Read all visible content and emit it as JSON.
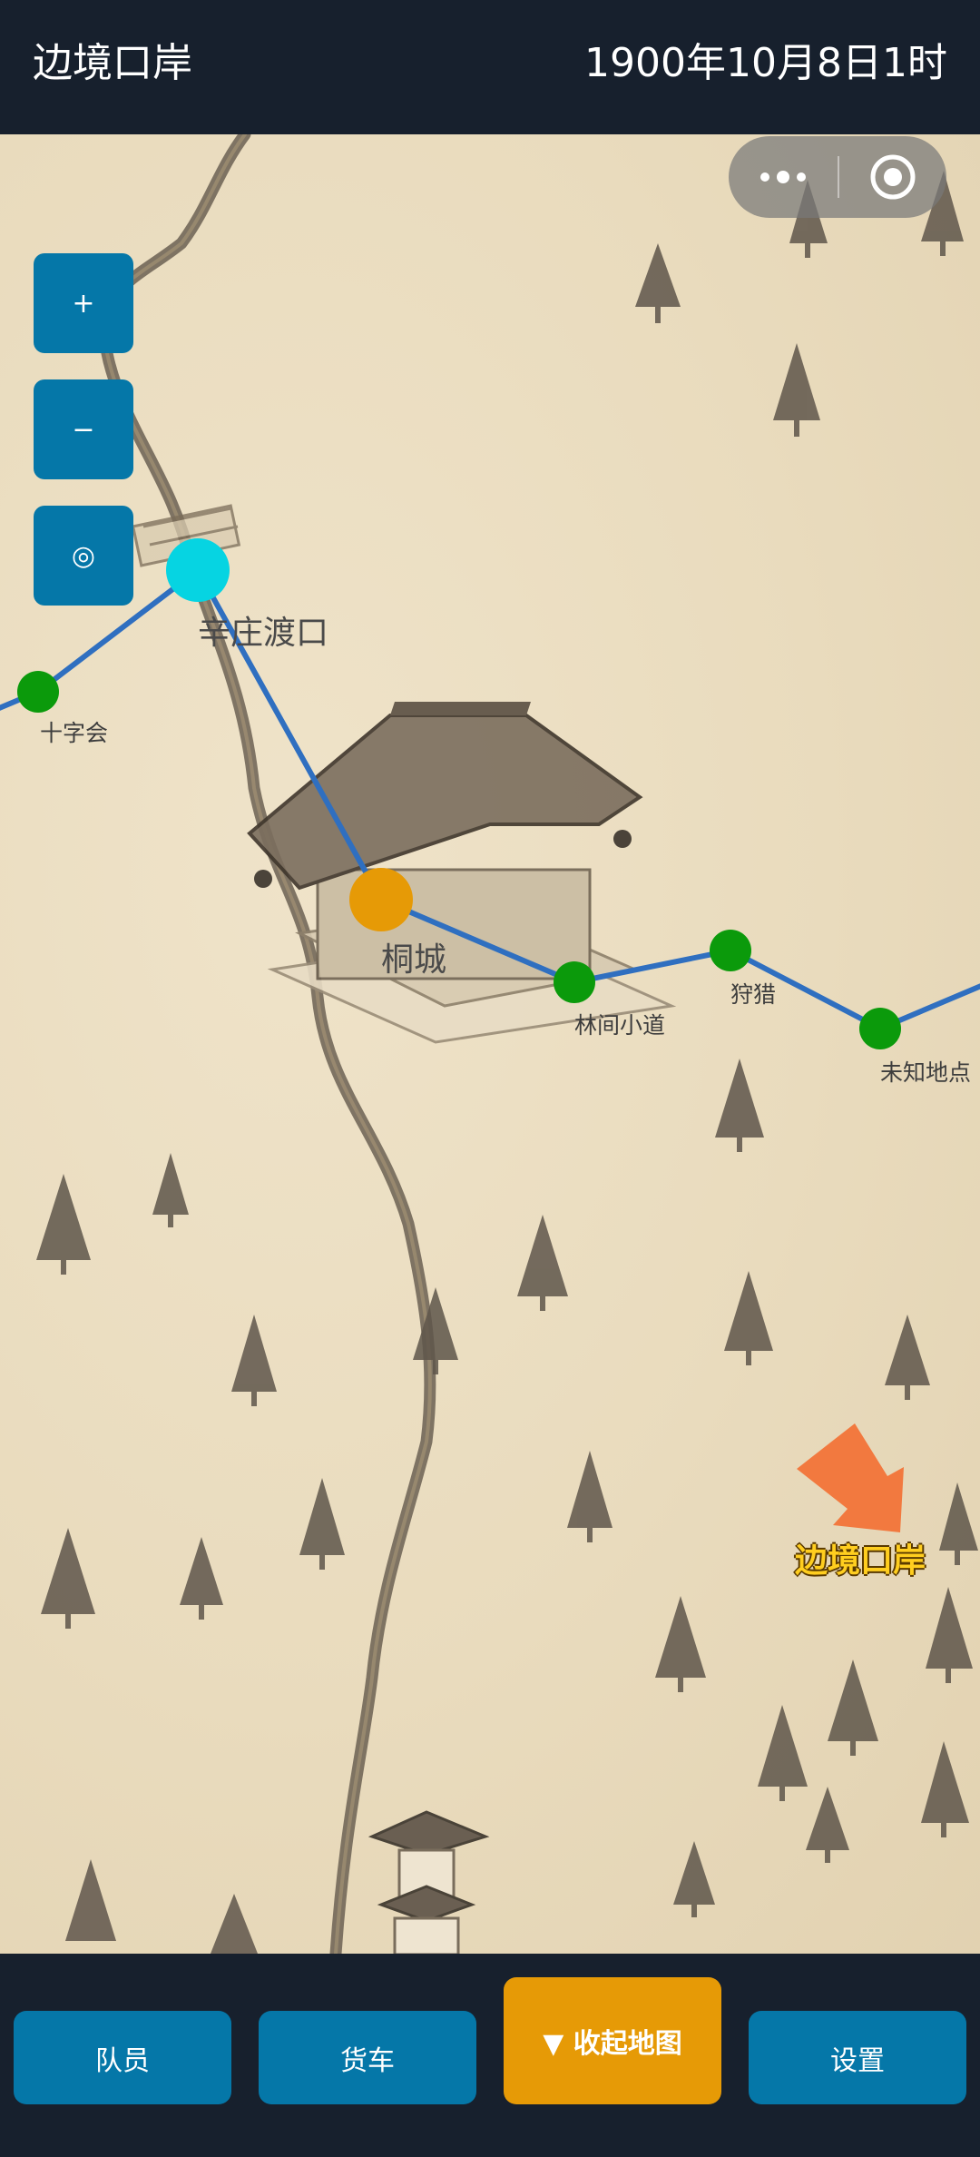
{
  "header": {
    "title": "边境口岸",
    "datetime": "1900年10月8日1时"
  },
  "capsule": {
    "more_icon": "more-dots-icon",
    "close_icon": "target-circle-icon"
  },
  "zoom_controls": {
    "zoom_in_label": "+",
    "zoom_out_label": "−",
    "locate_label": "◎"
  },
  "map": {
    "nodes": [
      {
        "name": "辛庄渡口",
        "status": "cyan"
      },
      {
        "name": "十字会",
        "status": "green"
      },
      {
        "name": "桐城",
        "status": "current"
      },
      {
        "name": "林间小道",
        "status": "green"
      },
      {
        "name": "狩猎",
        "status": "green"
      },
      {
        "name": "未知地点",
        "status": "green"
      }
    ],
    "destination": "边境口岸",
    "colors": {
      "route": "#2f6fc0",
      "node_green": "#0b9a0b",
      "node_cyan": "#06d4e2",
      "node_current": "#e69a06",
      "arrow": "#f2793f"
    }
  },
  "bottom_nav": {
    "team": "队员",
    "truck": "货车",
    "collapse_map": "▼ 收起地图",
    "settings": "设置"
  }
}
